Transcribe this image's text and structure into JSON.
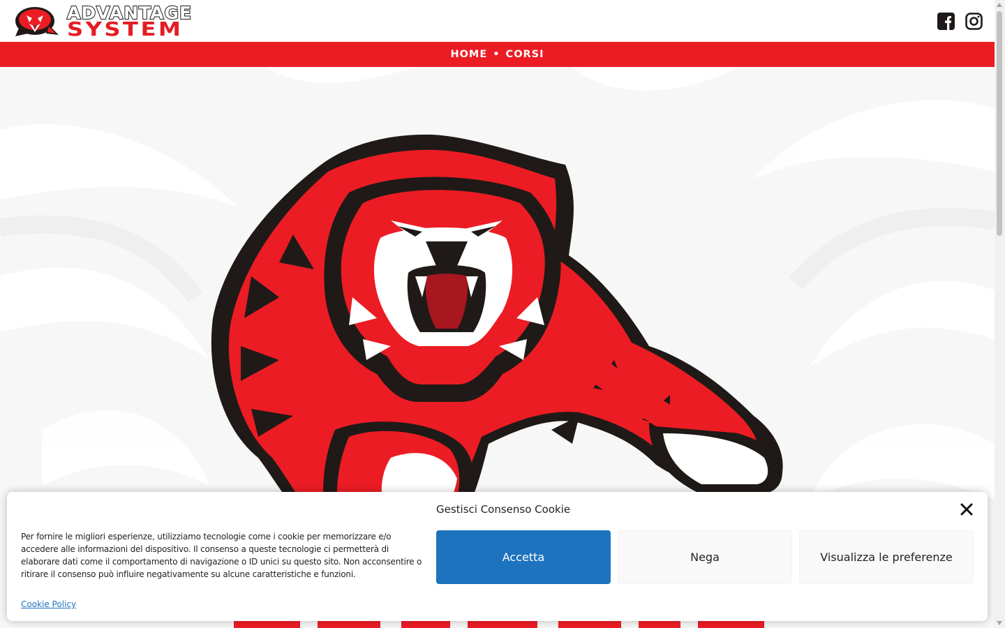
{
  "brand": {
    "line1": "ADVANTAGE",
    "line2": "SYSTEM",
    "colors": {
      "red": "#ec1c24",
      "dark": "#1f1a17",
      "blue": "#1e73be"
    }
  },
  "nav": {
    "items": [
      {
        "label": "HOME"
      },
      {
        "label": "CORSI"
      }
    ],
    "separator": "•"
  },
  "social": [
    {
      "icon": "facebook-icon"
    },
    {
      "icon": "instagram-icon"
    }
  ],
  "cookie_banner": {
    "title": "Gestisci Consenso Cookie",
    "text": "Per fornire le migliori esperienze, utilizziamo tecnologie come i cookie per memorizzare e/o accedere alle informazioni del dispositivo. Il consenso a queste tecnologie ci permetterà di elaborare dati come il comportamento di navigazione o ID unici su questo sito. Non acconsentire o ritirare il consenso può influire negativamente su alcune caratteristiche e funzioni.",
    "link": "Cookie Policy",
    "buttons": {
      "accept": "Accetta",
      "deny": "Nega",
      "preferences": "Visualizza le preferenze"
    }
  }
}
